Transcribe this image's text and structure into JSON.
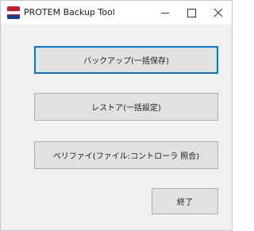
{
  "window": {
    "title": "PROTEM Backup Tool",
    "icon": "protem-app-icon",
    "controls": [
      "minimize-icon",
      "maximize-icon",
      "close-icon"
    ]
  },
  "buttons": {
    "backup": "バックアップ(一括保存)",
    "restore": "レストア(一括設定)",
    "verify": "ベリファイ(ファイル:コントローラ 照合)",
    "exit": "終了"
  },
  "colors": {
    "focus_border": "#0078d7",
    "button_bg": "#e1e1e1",
    "window_bg": "#f0f0f0",
    "icon_red": "#c2202b",
    "icon_blue": "#1b3e8c"
  }
}
